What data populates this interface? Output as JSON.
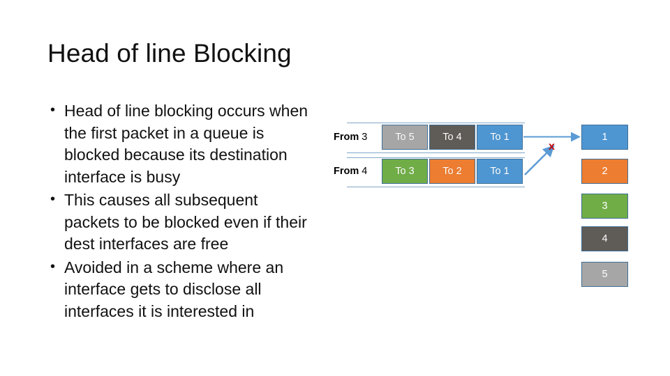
{
  "slide": {
    "title": "Head of line Blocking",
    "background_color": "#ffffff",
    "bullets": [
      {
        "marker": "•",
        "text": "Head of line blocking occurs when the first packet in a queue is blocked because its destination interface is busy"
      },
      {
        "marker": "•",
        "text": "This causes all subsequent packets to be blocked even if their dest interfaces are free"
      },
      {
        "marker": "•",
        "text": "Avoided in a scheme where an interface gets to disclose all interfaces it is interested in"
      }
    ]
  },
  "diagram": {
    "queues": [
      {
        "label_bold": "From",
        "label_number": "3",
        "packets": [
          {
            "text": "To 5",
            "color": "#a6a6a6"
          },
          {
            "text": "To 4",
            "color": "#5f5b57"
          },
          {
            "text": "To 1",
            "color": "#4e96d2"
          }
        ]
      },
      {
        "label_bold": "From",
        "label_number": "4",
        "packets": [
          {
            "text": "To 3",
            "color": "#70ad47"
          },
          {
            "text": "To 2",
            "color": "#ed7d31"
          },
          {
            "text": "To 1",
            "color": "#4e96d2"
          }
        ]
      }
    ],
    "interfaces": [
      {
        "text": "1",
        "color": "#4e96d2"
      },
      {
        "text": "2",
        "color": "#ed7d31"
      },
      {
        "text": "3",
        "color": "#70ad47"
      },
      {
        "text": "4",
        "color": "#5f5b57"
      },
      {
        "text": "5",
        "color": "#a6a6a6"
      }
    ],
    "blocked_marker": "x",
    "blocked_marker_color": "#c00000",
    "arrow_color": "#5b9bd5",
    "rail_color": "#7fa8c9",
    "box_border_color": "#3f6f96"
  }
}
